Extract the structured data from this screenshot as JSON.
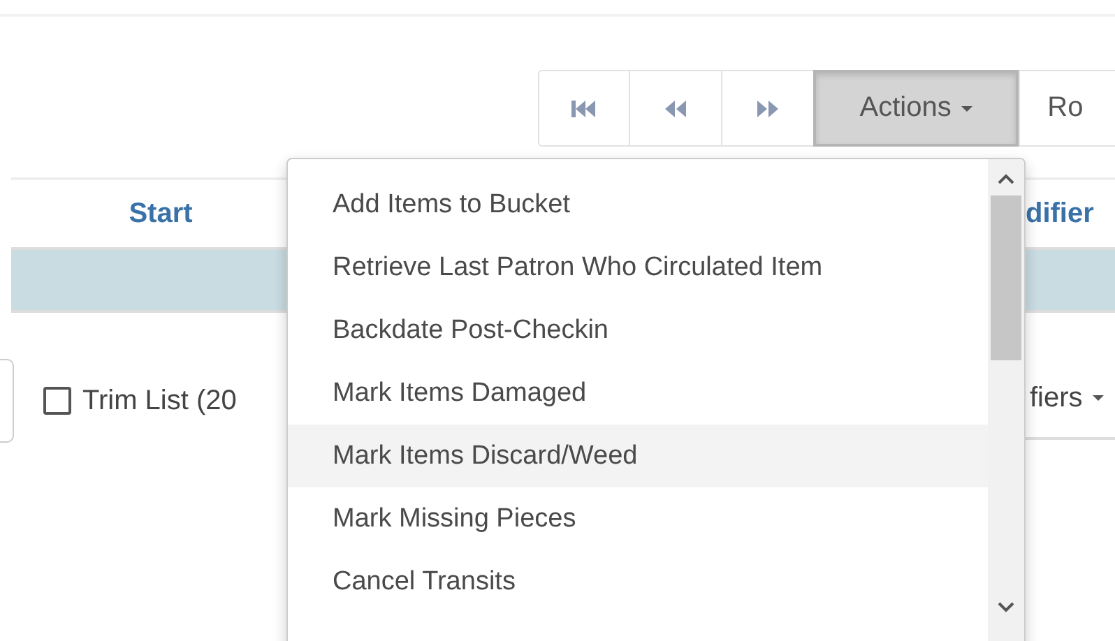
{
  "toolbar": {
    "actions_button": {
      "label": "Actions",
      "pressed": true
    },
    "cut_button": {
      "label": "Ro"
    }
  },
  "table": {
    "columns": [
      {
        "label": "Start"
      },
      {
        "label": "difier"
      }
    ]
  },
  "filter_row": {
    "trim_list": {
      "label": "Trim List (20",
      "checked": false
    },
    "modifiers_button": {
      "label": "fiers"
    }
  },
  "actions_menu": {
    "items": [
      {
        "label": "Add Items to Bucket",
        "highlighted": false
      },
      {
        "label": "Retrieve Last Patron Who Circulated Item",
        "highlighted": false
      },
      {
        "label": "Backdate Post-Checkin",
        "highlighted": false
      },
      {
        "label": "Mark Items Damaged",
        "highlighted": false
      },
      {
        "label": "Mark Items Discard/Weed",
        "highlighted": true
      },
      {
        "label": "Mark Missing Pieces",
        "highlighted": false
      },
      {
        "label": "Cancel Transits",
        "highlighted": false
      }
    ]
  }
}
